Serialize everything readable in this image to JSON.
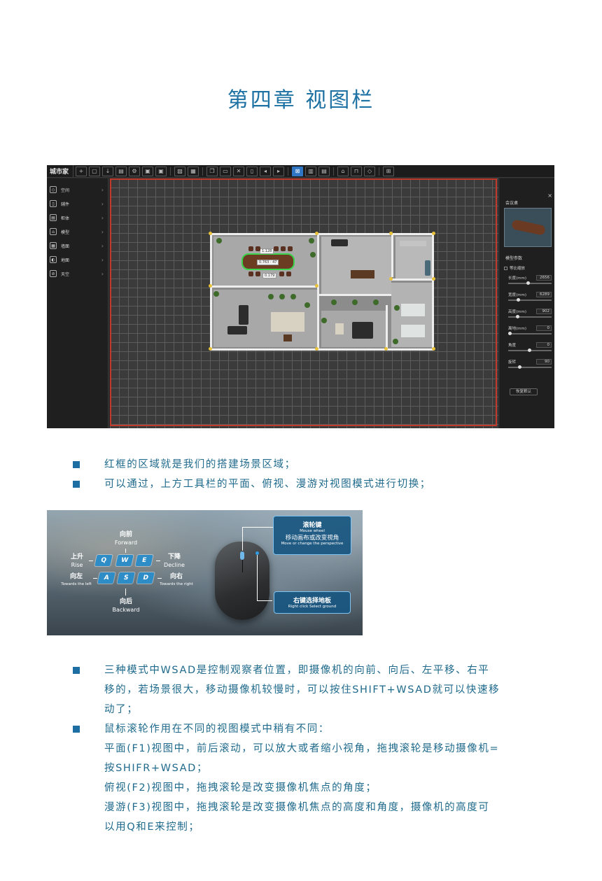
{
  "chapter_title": "第四章 视图栏",
  "editor": {
    "app_name": "城市家",
    "toolbar_icons": [
      "plus-icon",
      "file-icon",
      "download-icon",
      "folder-icon",
      "settings-icon",
      "save-icon",
      "save-as-icon",
      "image-icon",
      "layers-icon",
      "copy-icon",
      "paste-icon",
      "close-box-icon",
      "delete-icon",
      "import-icon",
      "export-icon",
      "plan-view-icon",
      "chart-icon",
      "table-icon",
      "camera-icon",
      "lock-icon",
      "eraser-icon",
      "grid-icon"
    ],
    "left_menu": [
      {
        "label": "空间",
        "icon": "cube-icon"
      },
      {
        "label": "辅件",
        "icon": "door-icon"
      },
      {
        "label": "柜体",
        "icon": "cabinet-icon"
      },
      {
        "label": "模型",
        "icon": "model-icon"
      },
      {
        "label": "墙面",
        "icon": "wall-icon"
      },
      {
        "label": "地面",
        "icon": "floor-icon"
      },
      {
        "label": "天空",
        "icon": "sky-icon"
      }
    ],
    "selection_labels": {
      "top": "1.128",
      "center": "0.763 · 47",
      "bottom": "0.179"
    },
    "right_panel": {
      "object_name": "会议桌",
      "section_title": "模型参数",
      "proportional_label": "等比缩放",
      "params": [
        {
          "label": "长度(mm)",
          "value": "2656",
          "fraction": 0.42
        },
        {
          "label": "宽度(mm)",
          "value": "6289",
          "fraction": 0.2
        },
        {
          "label": "高度(mm)",
          "value": "902",
          "fraction": 0.18
        },
        {
          "label": "离地(mm)",
          "value": "0",
          "fraction": 0.0
        },
        {
          "label": "角度",
          "value": "0",
          "fraction": 0.45
        },
        {
          "label": "旋转",
          "value": "90",
          "fraction": 0.22
        }
      ],
      "reset_label": "恢复默认"
    }
  },
  "bullets_1": [
    "红框的区域就是我们的搭建场景区域；",
    "可以通过，上方工具栏的平面、俯视、漫游对视图模式进行切换；"
  ],
  "controls": {
    "forward_zh": "向前",
    "forward_en": "Forward",
    "backward_zh": "向后",
    "backward_en": "Backward",
    "rise_zh": "上升",
    "rise_en": "Rise",
    "decline_zh": "下降",
    "decline_en": "Decline",
    "left_zh": "向左",
    "left_en": "Towards the left",
    "right_zh": "向右",
    "right_en": "Towards the right",
    "keys": {
      "q": "Q",
      "w": "W",
      "e": "E",
      "a": "A",
      "s": "S",
      "d": "D"
    },
    "wheel_title_zh": "滚轮键",
    "wheel_title_en": "Mouse wheel",
    "wheel_desc_zh": "移动画布或改变视角",
    "wheel_desc_en": "Move or change the perspective",
    "right_click_zh": "右键选择地板",
    "right_click_en": "Right click Select ground"
  },
  "bullets_2": {
    "item1_lines": [
      "三种模式中WSAD是控制观察者位置，即摄像机的向前、向后、左平移、右平",
      "移的，若场景很大，移动摄像机较慢时，可以按住SHIFT+WSAD就可以快速移",
      "动了；"
    ],
    "item2_lines": [
      "鼠标滚轮作用在不同的视图模式中稍有不同：",
      "平面(F1)视图中，前后滚动，可以放大或者缩小视角，拖拽滚轮是移动摄像机=",
      "按SHIFR+WSAD；",
      "俯视(F2)视图中，拖拽滚轮是改变摄像机焦点的角度；",
      "漫游(F3)视图中，拖拽滚轮是改变摄像机焦点的高度和角度，摄像机的高度可",
      "以用Q和E来控制；"
    ]
  }
}
